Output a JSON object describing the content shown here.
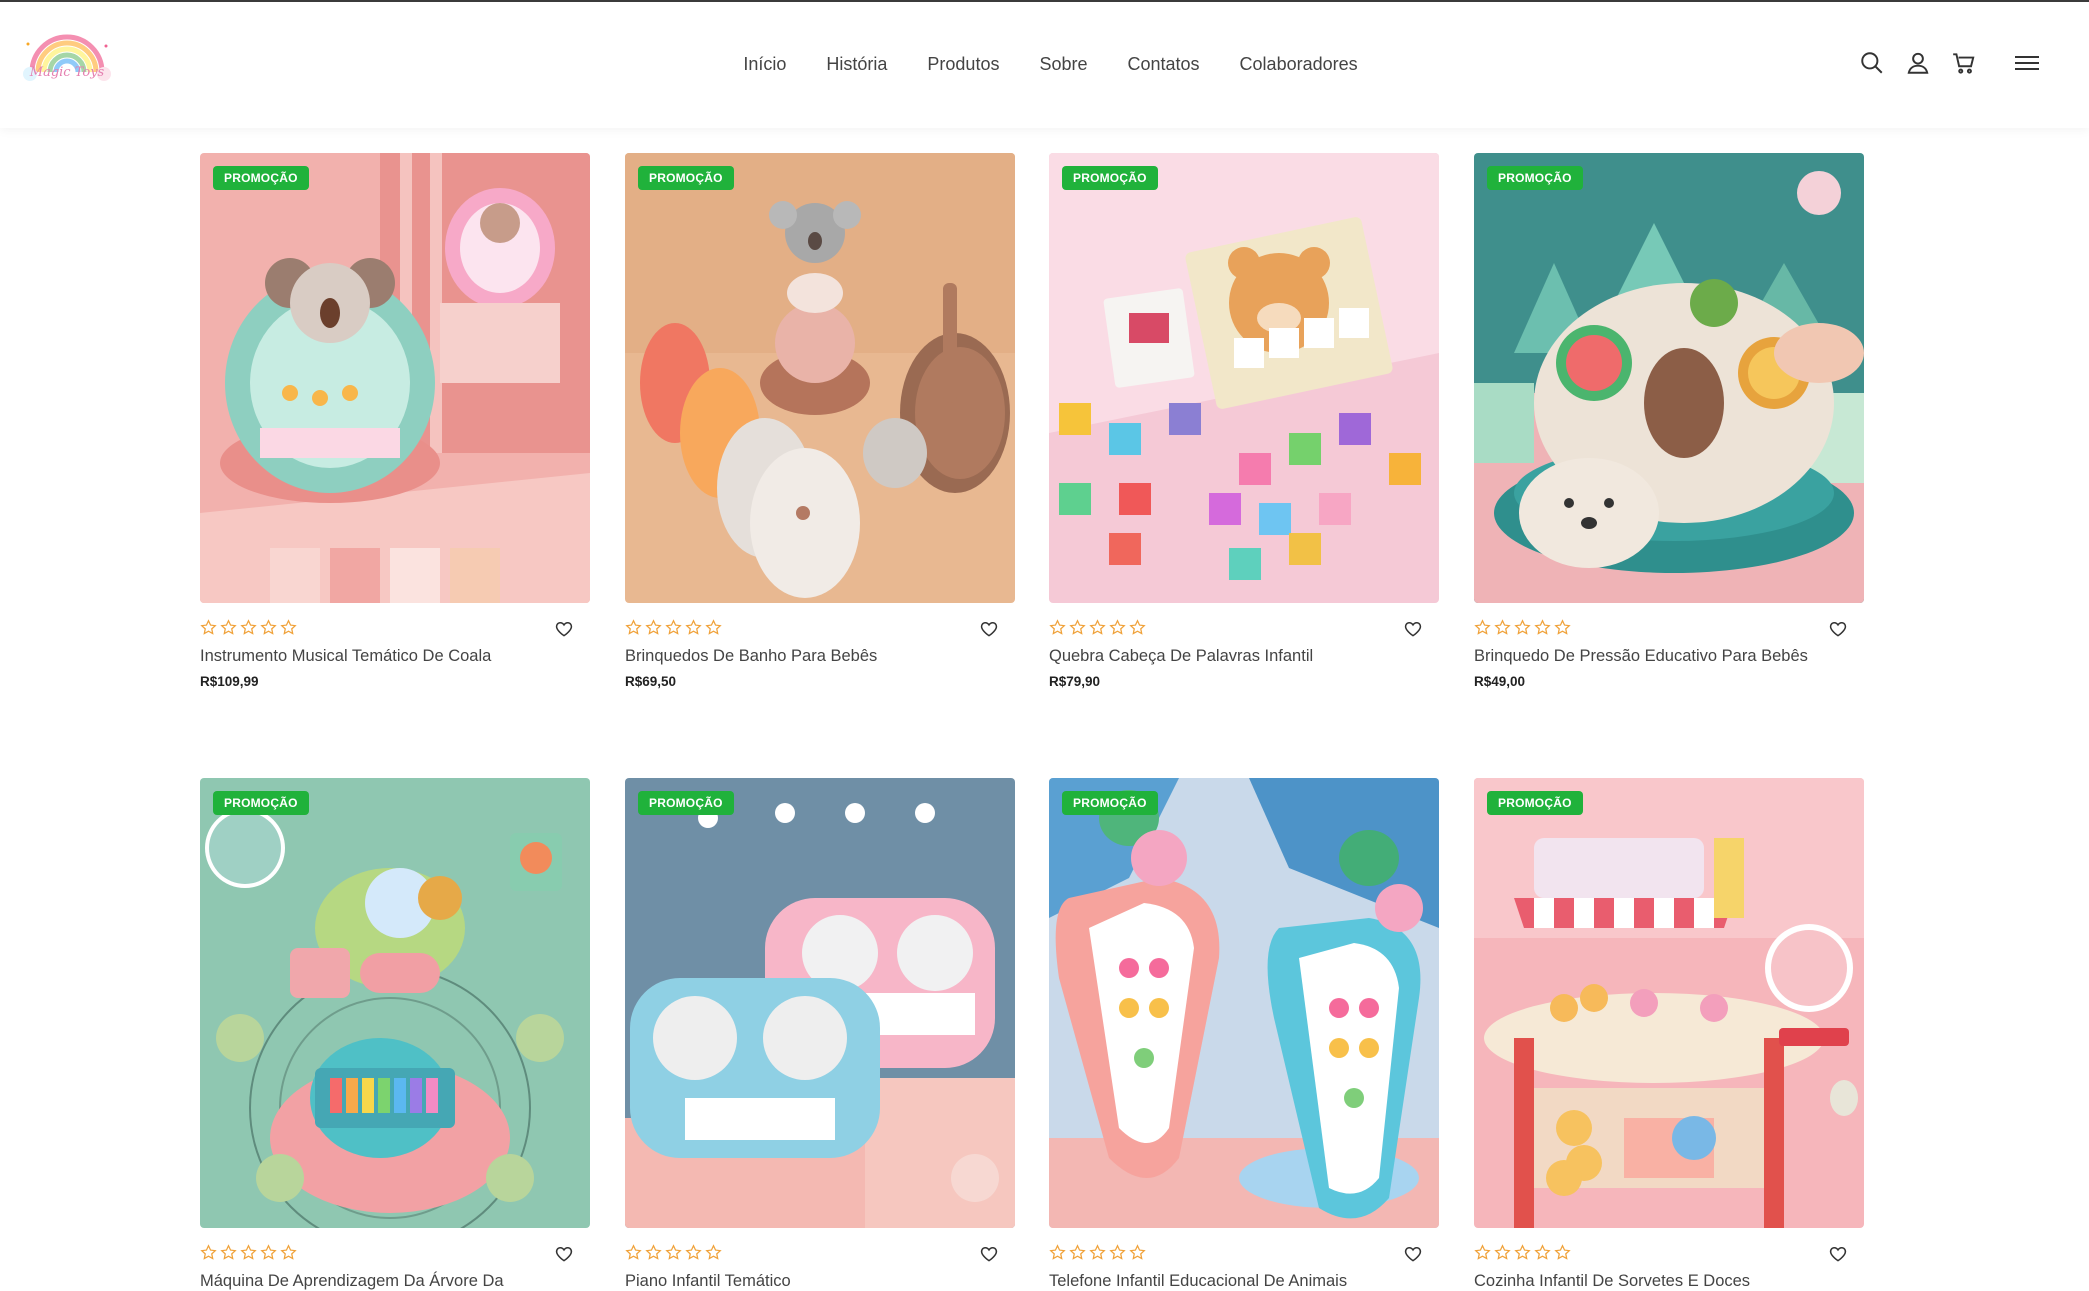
{
  "brand": {
    "logo_text": "Magic Toys"
  },
  "nav": {
    "items": [
      "Início",
      "História",
      "Produtos",
      "Sobre",
      "Contatos",
      "Colaboradores"
    ]
  },
  "header_icons": [
    "search-icon",
    "user-icon",
    "cart-icon",
    "menu-icon"
  ],
  "colors": {
    "badge": "#20b23b",
    "star": "#f0a23a"
  },
  "products": [
    {
      "badge": "PROMOÇÃO",
      "name": "Instrumento Musical Temático De Coala",
      "price": "R$109,99",
      "rating": 0
    },
    {
      "badge": "PROMOÇÃO",
      "name": "Brinquedos De Banho Para Bebês",
      "price": "R$69,50",
      "rating": 0
    },
    {
      "badge": "PROMOÇÃO",
      "name": "Quebra Cabeça De Palavras Infantil",
      "price": "R$79,90",
      "rating": 0
    },
    {
      "badge": "PROMOÇÃO",
      "name": "Brinquedo De Pressão Educativo Para Bebês",
      "price": "R$49,00",
      "rating": 0
    },
    {
      "badge": "PROMOÇÃO",
      "name": "Máquina De Aprendizagem Da Árvore Da",
      "price": "",
      "rating": 0
    },
    {
      "badge": "PROMOÇÃO",
      "name": "Piano Infantil Temático",
      "price": "",
      "rating": 0
    },
    {
      "badge": "PROMOÇÃO",
      "name": "Telefone Infantil Educacional De Animais",
      "price": "",
      "rating": 0
    },
    {
      "badge": "PROMOÇÃO",
      "name": "Cozinha Infantil De Sorvetes E Doces",
      "price": "",
      "rating": 0
    }
  ]
}
